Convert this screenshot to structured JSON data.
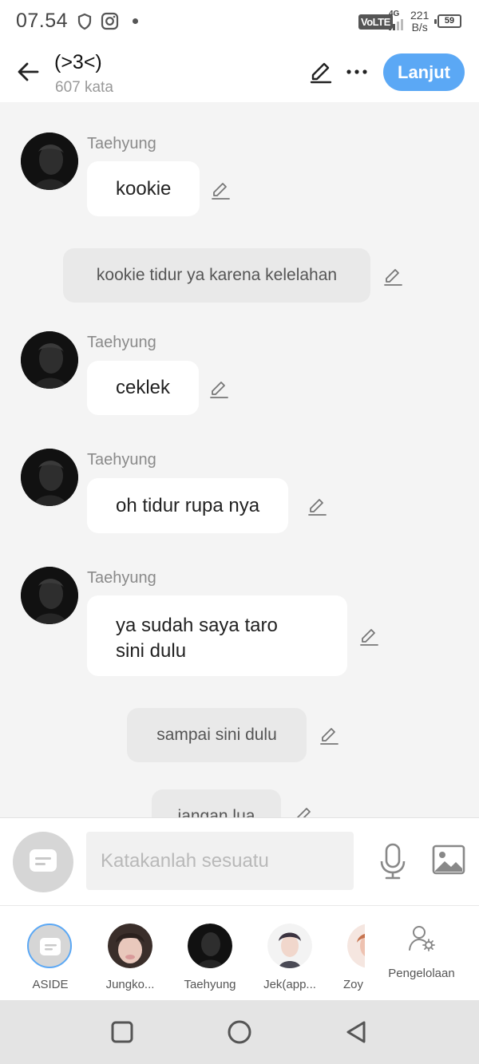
{
  "status_bar": {
    "time": "07.54",
    "volte": "VoLTE",
    "network": "4G",
    "speed_value": "221",
    "speed_unit": "B/s",
    "battery": "59"
  },
  "header": {
    "title": "(>3<)",
    "subtitle": "607 kata",
    "next_label": "Lanjut"
  },
  "messages": [
    {
      "sender": "Taehyung",
      "text": "kookie"
    },
    {
      "narration": "kookie tidur ya karena kelelahan"
    },
    {
      "sender": "Taehyung",
      "text": "ceklek"
    },
    {
      "sender": "Taehyung",
      "text": "oh tidur rupa nya"
    },
    {
      "sender": "Taehyung",
      "text_line1": "ya sudah saya taro",
      "text_line2": "sini dulu"
    },
    {
      "narration": "sampai sini dulu"
    },
    {
      "narration": "jangan lua"
    }
  ],
  "input": {
    "placeholder": "Katakanlah sesuatu"
  },
  "characters": [
    {
      "name": "ASIDE"
    },
    {
      "name": "Jungko..."
    },
    {
      "name": "Taehyung"
    },
    {
      "name": "Jek(app..."
    },
    {
      "name": "Zoy"
    }
  ],
  "manage_label": "Pengelolaan",
  "colors": {
    "accent": "#5ba8f5",
    "background": "#f4f4f4",
    "bubble": "#ffffff",
    "narration_bubble": "#e9e9e9"
  },
  "icons": {
    "back": "arrow-left-icon",
    "edit": "pencil-icon",
    "more": "more-horizontal-icon",
    "mic": "microphone-icon",
    "image": "image-icon",
    "manage": "user-gear-icon"
  }
}
